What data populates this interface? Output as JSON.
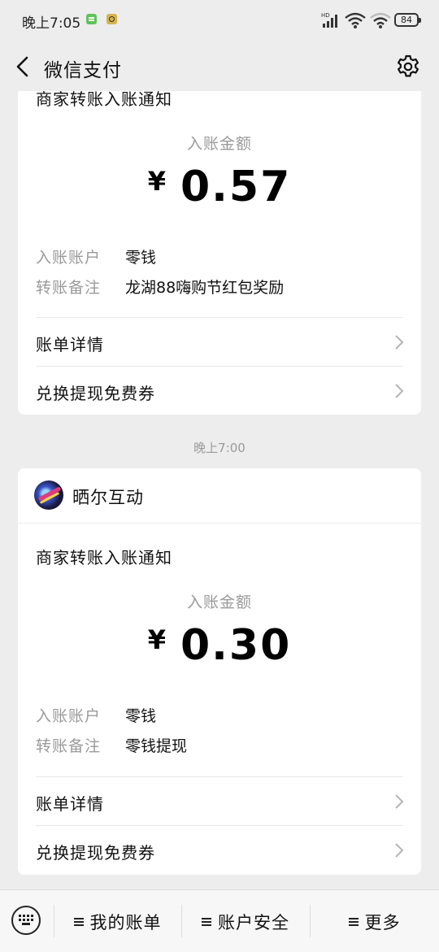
{
  "status_bar": {
    "time": "晚上7:05",
    "network_label": "HD",
    "battery": "84"
  },
  "nav": {
    "title": "微信支付"
  },
  "cards": [
    {
      "title": "商家转账入账通知",
      "amount_label": "入账金额",
      "currency": "¥",
      "amount": "0.57",
      "fields": [
        {
          "key": "入账账户",
          "value": "零钱"
        },
        {
          "key": "转账备注",
          "value": "龙湖88嗨购节红包奖励"
        }
      ],
      "links": [
        "账单详情",
        "兑换提现免费券"
      ]
    },
    {
      "merchant": "晒尔互动",
      "title": "商家转账入账通知",
      "amount_label": "入账金额",
      "currency": "¥",
      "amount": "0.30",
      "fields": [
        {
          "key": "入账账户",
          "value": "零钱"
        },
        {
          "key": "转账备注",
          "value": "零钱提现"
        }
      ],
      "links": [
        "账单详情",
        "兑换提现免费券"
      ]
    }
  ],
  "timestamp": "晚上7:00",
  "bottom_bar": {
    "items": [
      "我的账单",
      "账户安全",
      "更多"
    ]
  },
  "icons": {
    "back": "back-arrow-icon",
    "settings": "gear-icon",
    "chevron": "chevron-right-icon",
    "keyboard": "keyboard-icon",
    "menu": "menu-icon"
  },
  "colors": {
    "background": "#ededed",
    "card": "#ffffff",
    "muted_text": "#9a9a9a"
  }
}
